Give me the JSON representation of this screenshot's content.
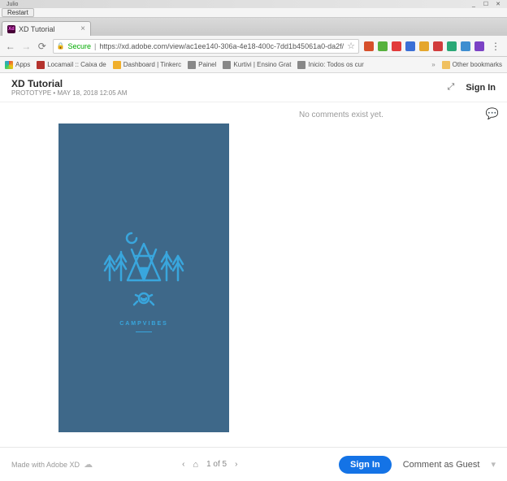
{
  "os": {
    "user": "Julio",
    "min": "_",
    "max": "☐",
    "close": "✕"
  },
  "restart": {
    "label": "Restart"
  },
  "tab": {
    "title": "XD Tutorial",
    "favicon": "Xd",
    "close": "×"
  },
  "nav": {
    "back": "←",
    "forward": "→",
    "reload": "⟳"
  },
  "url": {
    "lock": "🔒",
    "secure": "Secure",
    "text": "https://xd.adobe.com/view/ac1ee140-306a-4e18-400c-7dd1b45061a0-da2f/",
    "star": "☆"
  },
  "ext_colors": [
    "#d64f2a",
    "#56b13d",
    "#e23a3a",
    "#3a6fd6",
    "#e5a62c",
    "#d13c3c",
    "#2aa876",
    "#3e8ed0",
    "#7b42c5"
  ],
  "menu": "⋮",
  "bookmarks": {
    "apps": "Apps",
    "items": [
      {
        "label": "Locamail :: Caixa de",
        "color": "#b5332e"
      },
      {
        "label": "Dashboard | Tinkerc",
        "color": "#f0af2c"
      },
      {
        "label": "Painel",
        "color": "#888"
      },
      {
        "label": "Kurtivi | Ensino Grat",
        "color": "#888"
      },
      {
        "label": "Inicio: Todos os cur",
        "color": "#888"
      }
    ],
    "other": "Other bookmarks",
    "chevron": "»"
  },
  "header": {
    "title": "XD Tutorial",
    "subtitle": "PROTOTYPE  •  May 18, 2018 12:05 AM",
    "fullscreen": "⤢",
    "signin": "Sign In"
  },
  "artboard": {
    "brand": "CAMPVIBES"
  },
  "comments": {
    "empty": "No comments exist yet.",
    "bubble": "💬"
  },
  "footer": {
    "made_with": "Made with Adobe XD",
    "cloud": "☁",
    "prev": "‹",
    "home": "⌂",
    "page_label": "1 of 5",
    "next": "›",
    "signin_btn": "Sign In",
    "guest": "Comment as Guest",
    "filter": "▾"
  }
}
